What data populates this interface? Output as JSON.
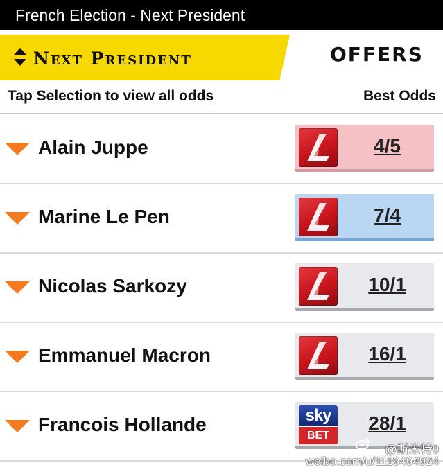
{
  "header": {
    "title": "French Election - Next President"
  },
  "tabs": {
    "market_label": "Next President",
    "offers_label": "OFFERS"
  },
  "subheader": {
    "left": "Tap Selection to view all odds",
    "right": "Best Odds"
  },
  "colors": {
    "accent_yellow": "#f7d800",
    "arrow_orange": "#f47a20",
    "highlight_pink": "#f6c1c4",
    "highlight_blue": "#b9d6f2",
    "neutral_grey": "#e8e9ec"
  },
  "selections": [
    {
      "name": "Alain Juppe",
      "odds": "4/5",
      "bookmaker_icon": "ladbrokes-l-icon"
    },
    {
      "name": "Marine Le Pen",
      "odds": "7/4",
      "bookmaker_icon": "ladbrokes-l-icon"
    },
    {
      "name": "Nicolas Sarkozy",
      "odds": "10/1",
      "bookmaker_icon": "ladbrokes-l-icon"
    },
    {
      "name": "Emmanuel Macron",
      "odds": "16/1",
      "bookmaker_icon": "ladbrokes-l-icon"
    },
    {
      "name": "Francois Hollande",
      "odds": "28/1",
      "bookmaker_icon": "sky-bet-icon",
      "bookmaker_logo_text": {
        "top": "sky",
        "bottom": "BET"
      }
    }
  ],
  "watermark": {
    "line1": "@斯米特9",
    "line2": "weibo.com/u/1119494924"
  }
}
